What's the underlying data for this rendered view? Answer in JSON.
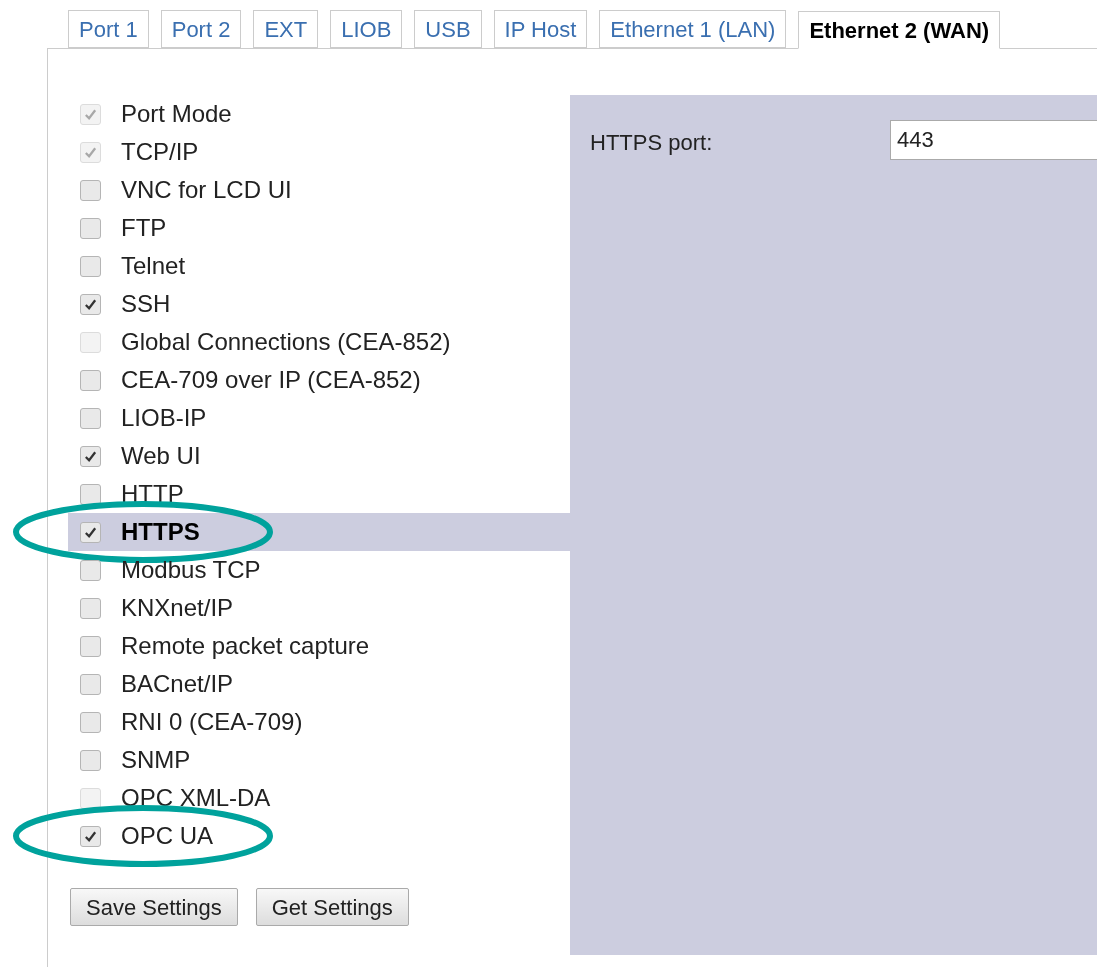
{
  "tabs": [
    {
      "label": "Port 1",
      "selected": false
    },
    {
      "label": "Port 2",
      "selected": false
    },
    {
      "label": "EXT",
      "selected": false
    },
    {
      "label": "LIOB",
      "selected": false
    },
    {
      "label": "USB",
      "selected": false
    },
    {
      "label": "IP Host",
      "selected": false
    },
    {
      "label": "Ethernet 1 (LAN)",
      "selected": false
    },
    {
      "label": "Ethernet 2 (WAN)",
      "selected": true
    }
  ],
  "items": [
    {
      "label": "Port Mode",
      "checked": true,
      "disabled": true,
      "selected": false,
      "circled": false
    },
    {
      "label": "TCP/IP",
      "checked": true,
      "disabled": true,
      "selected": false,
      "circled": false
    },
    {
      "label": "VNC for LCD UI",
      "checked": false,
      "disabled": false,
      "selected": false,
      "circled": false
    },
    {
      "label": "FTP",
      "checked": false,
      "disabled": false,
      "selected": false,
      "circled": false
    },
    {
      "label": "Telnet",
      "checked": false,
      "disabled": false,
      "selected": false,
      "circled": false
    },
    {
      "label": "SSH",
      "checked": true,
      "disabled": false,
      "selected": false,
      "circled": false
    },
    {
      "label": "Global Connections (CEA-852)",
      "checked": false,
      "disabled": true,
      "selected": false,
      "circled": false
    },
    {
      "label": "CEA-709 over IP (CEA-852)",
      "checked": false,
      "disabled": false,
      "selected": false,
      "circled": false
    },
    {
      "label": "LIOB-IP",
      "checked": false,
      "disabled": false,
      "selected": false,
      "circled": false
    },
    {
      "label": "Web UI",
      "checked": true,
      "disabled": false,
      "selected": false,
      "circled": false
    },
    {
      "label": "HTTP",
      "checked": false,
      "disabled": false,
      "selected": false,
      "circled": false
    },
    {
      "label": "HTTPS",
      "checked": true,
      "disabled": false,
      "selected": true,
      "circled": true
    },
    {
      "label": "Modbus TCP",
      "checked": false,
      "disabled": false,
      "selected": false,
      "circled": false
    },
    {
      "label": "KNXnet/IP",
      "checked": false,
      "disabled": false,
      "selected": false,
      "circled": false
    },
    {
      "label": "Remote packet capture",
      "checked": false,
      "disabled": false,
      "selected": false,
      "circled": false
    },
    {
      "label": "BACnet/IP",
      "checked": false,
      "disabled": false,
      "selected": false,
      "circled": false
    },
    {
      "label": "RNI 0 (CEA-709)",
      "checked": false,
      "disabled": false,
      "selected": false,
      "circled": false
    },
    {
      "label": "SNMP",
      "checked": false,
      "disabled": false,
      "selected": false,
      "circled": false
    },
    {
      "label": "OPC XML-DA",
      "checked": false,
      "disabled": true,
      "selected": false,
      "circled": false
    },
    {
      "label": "OPC UA",
      "checked": true,
      "disabled": false,
      "selected": false,
      "circled": true
    }
  ],
  "buttons": [
    "Save Settings",
    "Get Settings"
  ],
  "detail": {
    "label": "HTTPS port:",
    "value": "443"
  }
}
